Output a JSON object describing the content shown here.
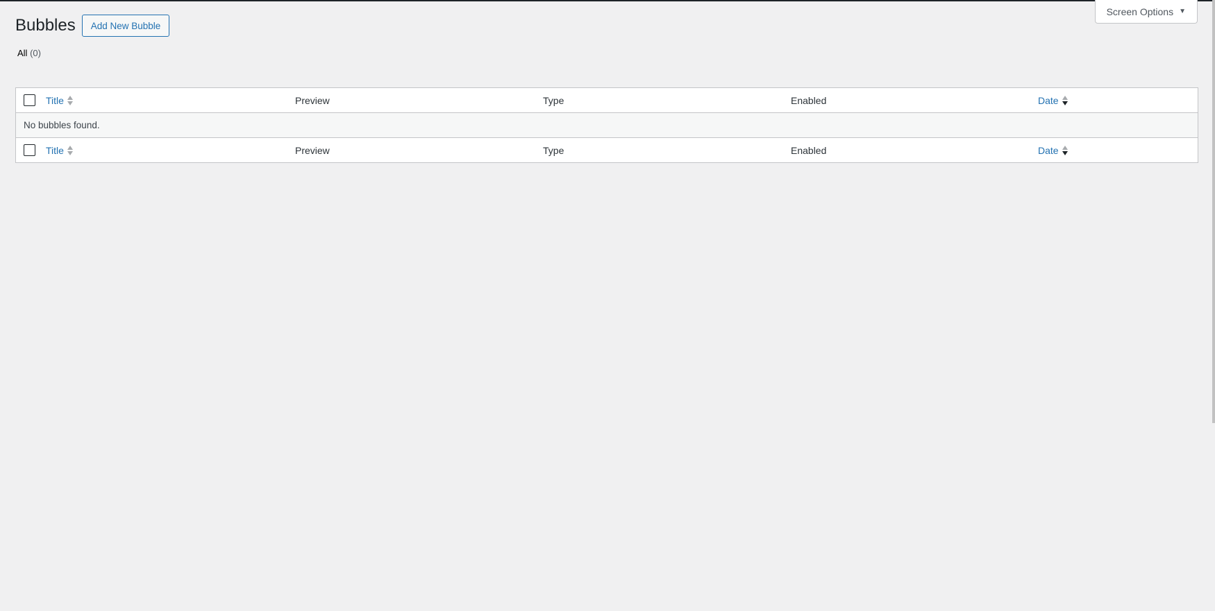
{
  "header": {
    "screen_options_label": "Screen Options",
    "title": "Bubbles",
    "add_button_label": "Add New Bubble"
  },
  "filters": {
    "all_label": "All",
    "all_count": "(0)"
  },
  "table": {
    "columns": {
      "title": "Title",
      "preview": "Preview",
      "type": "Type",
      "enabled": "Enabled",
      "date": "Date"
    },
    "empty_message": "No bubbles found."
  },
  "colors": {
    "accent": "#2271b1",
    "background": "#f0f0f1"
  }
}
